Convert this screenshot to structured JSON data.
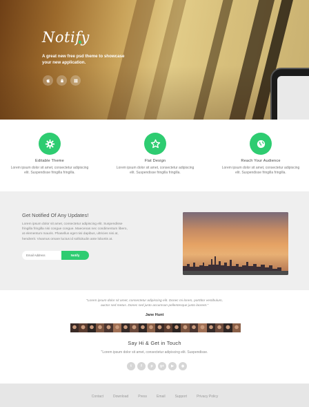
{
  "hero": {
    "logo": "Notify",
    "tagline": "A great new free psd theme to showcase your new application.",
    "store_icons": [
      "apple-icon",
      "android-icon",
      "windows-icon"
    ]
  },
  "features": [
    {
      "icon": "gear-icon",
      "title": "Editable Theme",
      "desc": "Lorem ipsum dolor sit amet, consectetur adipiscing elit. Suspendisse fringilla fringilla."
    },
    {
      "icon": "star-icon",
      "title": "Flat Design",
      "desc": "Lorem ipsum dolor sit amet, consectetur adipiscing elit. Suspendisse fringilla fringilla."
    },
    {
      "icon": "globe-icon",
      "title": "Reach Your Audience",
      "desc": "Lorem ipsum dolor sit amet, consectetur adipiscing elit. Suspendisse fringilla fringilla."
    }
  ],
  "notify": {
    "title": "Get Notified Of Any Updates!",
    "text": "Lorem ipsum dolor sit amet, consectetur adipiscing elit. Suspendisse fringilla fringilla nisi congue congue. Maecenas nec condimentum libero, at elementum mauris. Phasellus eget nisi dapibus, ultricies nisi at, hendrerit. Vivamus ornare luctus id sollicitudin ante lobortis at.",
    "email_placeholder": "Email Address",
    "button_label": "Notify"
  },
  "testimonial": {
    "quote": "\"Lorem ipsum dolor sit amet, consectetur adipiscing elit. Donec mi lorem, porttitor vestibulum, auctor sed metus. Donec sed justo accumsan pellentesque justo laoreet.\"",
    "author": "Jane Hunt",
    "avatar_count": 20
  },
  "contact": {
    "title": "Say Hi & Get in Touch",
    "subtitle": "\"Lorem ipsum dolor sit amet, consectetur adipiscing elit. Suspendisse.",
    "socials": [
      {
        "icon": "twitter-icon",
        "glyph": "t"
      },
      {
        "icon": "facebook-icon",
        "glyph": "f"
      },
      {
        "icon": "pinterest-icon",
        "glyph": "p"
      },
      {
        "icon": "google-plus-icon",
        "glyph": "g+"
      },
      {
        "icon": "youtube-icon",
        "glyph": "▶"
      },
      {
        "icon": "github-icon",
        "glyph": "◉"
      }
    ]
  },
  "footer": {
    "links": [
      "Contact",
      "Download",
      "Press",
      "Email",
      "Support",
      "Privacy Policy"
    ]
  },
  "colors": {
    "accent": "#2ecc71",
    "feature_bg": "#ffffff",
    "notify_bg": "#efefef",
    "footer_bg": "#e6e6e6"
  }
}
